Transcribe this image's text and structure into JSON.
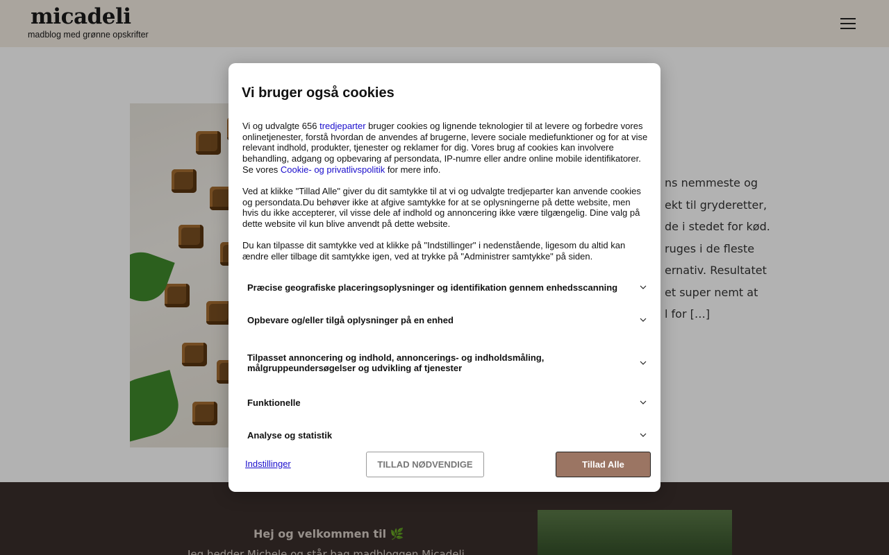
{
  "header": {
    "logo": "micadeli",
    "tagline": "madblog med grønne opskrifter",
    "menu_icon": "hamburger-menu-icon"
  },
  "article": {
    "excerpt_lines": [
      "ns nemmeste og",
      "ekt til gryderetter,",
      "de i stedet for kød.",
      "ruges i de fleste",
      "ernativ. Resultatet",
      "et super nemt at",
      "l for […]"
    ]
  },
  "footer": {
    "welcome_title": "Hej og velkommen til 🌿",
    "welcome_text": "Jeg hedder Michele og står bag madbloggen Micadeli"
  },
  "cookie_modal": {
    "title": "Vi bruger også cookies",
    "p1_before": "Vi og udvalgte 656 ",
    "p1_link1": "tredjeparter",
    "p1_middle": " bruger cookies og lignende teknologier til at levere og forbedre vores onlinetjenester, forstå hvordan de anvendes af brugerne, levere sociale mediefunktioner og for at vise relevant indhold, produkter, tjenester og reklamer for dig. Vores brug af cookies kan involvere behandling, adgang og opbevaring af persondata, IP-numre eller andre online mobile identifikatorer. Se vores ",
    "p1_link2": "Cookie- og privatlivspolitik",
    "p1_after": " for mere info.",
    "p2": "Ved at klikke \"Tillad Alle\" giver du dit samtykke til at vi og udvalgte tredjeparter kan anvende cookies og persondata.Du behøver ikke at afgive samtykke for at se oplysningerne på dette website, men hvis du ikke accepterer, vil visse dele af indhold og annoncering ikke være tilgængelig. Dine valg på dette website vil kun blive anvendt på dette website.",
    "p3": "Du kan tilpasse dit samtykke ved at klikke på \"Indstillinger\" i nedenstående, ligesom du altid kan ændre eller tilbage dit samtykke igen, ved at trykke på \"Administrer samtykke\" på siden.",
    "sections": [
      "Præcise geografiske placeringsoplysninger og identifikation gennem enhedsscanning",
      "Opbevare og/eller tilgå oplysninger på en enhed",
      "Tilpasset annoncering og indhold, annoncerings- og indholdsmåling, målgruppeundersøgelser og udvikling af tjenester",
      "Funktionelle",
      "Analyse og statistik"
    ],
    "settings_label": "Indstillinger",
    "necessary_label": "TILLAD NØDVENDIGE",
    "allow_all_label": "Tillad Alle",
    "accent_color": "#9b7563"
  }
}
